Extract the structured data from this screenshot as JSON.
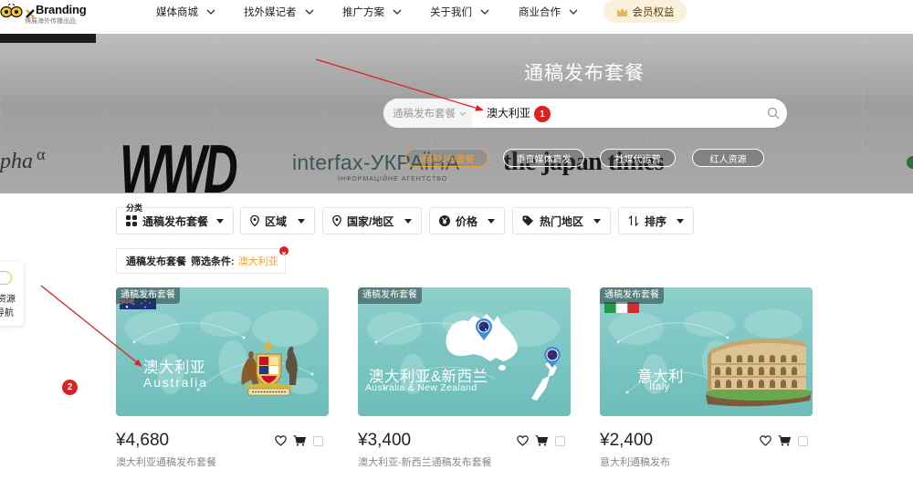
{
  "colors": {
    "accent": "#f0a23a",
    "annotation": "#e02020",
    "card_teal": "#76c4c1",
    "text_main": "#222222",
    "text_muted": "#888888",
    "member_bg": "#fbf0d9"
  },
  "nav": {
    "brand": "Branding",
    "tagline": "博展海外传播出品",
    "brand_icon": "bee-logo-icon",
    "items": [
      {
        "label": "媒体商城",
        "icon": "chevron-down-icon"
      },
      {
        "label": "找外媒记者",
        "icon": "chevron-down-icon"
      },
      {
        "label": "推广方案",
        "icon": "chevron-down-icon"
      },
      {
        "label": "关于我们",
        "icon": "chevron-down-icon"
      },
      {
        "label": "商业合作",
        "icon": "chevron-down-icon"
      }
    ],
    "member": {
      "label": "会员权益",
      "icon": "crown-icon"
    }
  },
  "hero": {
    "title": "通稿发布套餐",
    "media_logos": {
      "alpha": "pha",
      "alpha_symbol": "α",
      "wwd": "WWD",
      "interfax": "interfax-УКРАЇНА",
      "interfax_sub": "ІНФОРМАЦІЙНЕ АГЕНТСТВО",
      "japantimes": "the japan times"
    },
    "search": {
      "category": "通稿发布套餐",
      "value": "澳大利亚",
      "icon": "search-icon"
    },
    "quick_tags": [
      {
        "label": "通稿发布套餐",
        "active": true
      },
      {
        "label": "垂直媒体直发",
        "active": false
      },
      {
        "label": "社媒代运营",
        "active": false
      },
      {
        "label": "红人资源",
        "active": false
      }
    ]
  },
  "filters": {
    "label": "分类",
    "items": [
      {
        "label": "通稿发布套餐",
        "icon": "grid-icon"
      },
      {
        "label": "区域",
        "icon": "location-pin-icon"
      },
      {
        "label": "国家/地区",
        "icon": "location-pin-icon"
      },
      {
        "label": "价格",
        "icon": "yen-icon"
      },
      {
        "label": "热门地区",
        "icon": "tag-icon"
      },
      {
        "label": "排序",
        "icon": "sort-icon"
      }
    ],
    "condition": {
      "category": "通稿发布套餐",
      "prefix": "筛选条件:",
      "value": "澳大利亚"
    }
  },
  "side_panel": {
    "items": [
      "资源",
      "导航"
    ]
  },
  "annotations": [
    "1",
    "2"
  ],
  "cards": [
    {
      "tag": "通稿发布套餐",
      "title_cn": "澳大利亚",
      "title_en": "Australia",
      "price": "¥4,680",
      "name": "澳大利亚通稿发布套餐"
    },
    {
      "tag": "通稿发布套餐",
      "title_cn": "澳大利亚&新西兰",
      "title_en": "Australia & New Zealand",
      "price": "¥3,400",
      "name": "澳大利亚-新西兰通稿发布套餐"
    },
    {
      "tag": "通稿发布套餐",
      "title_cn": "意大利",
      "title_en": "Italy",
      "price": "¥2,400",
      "name": "意大利通稿发布"
    }
  ]
}
